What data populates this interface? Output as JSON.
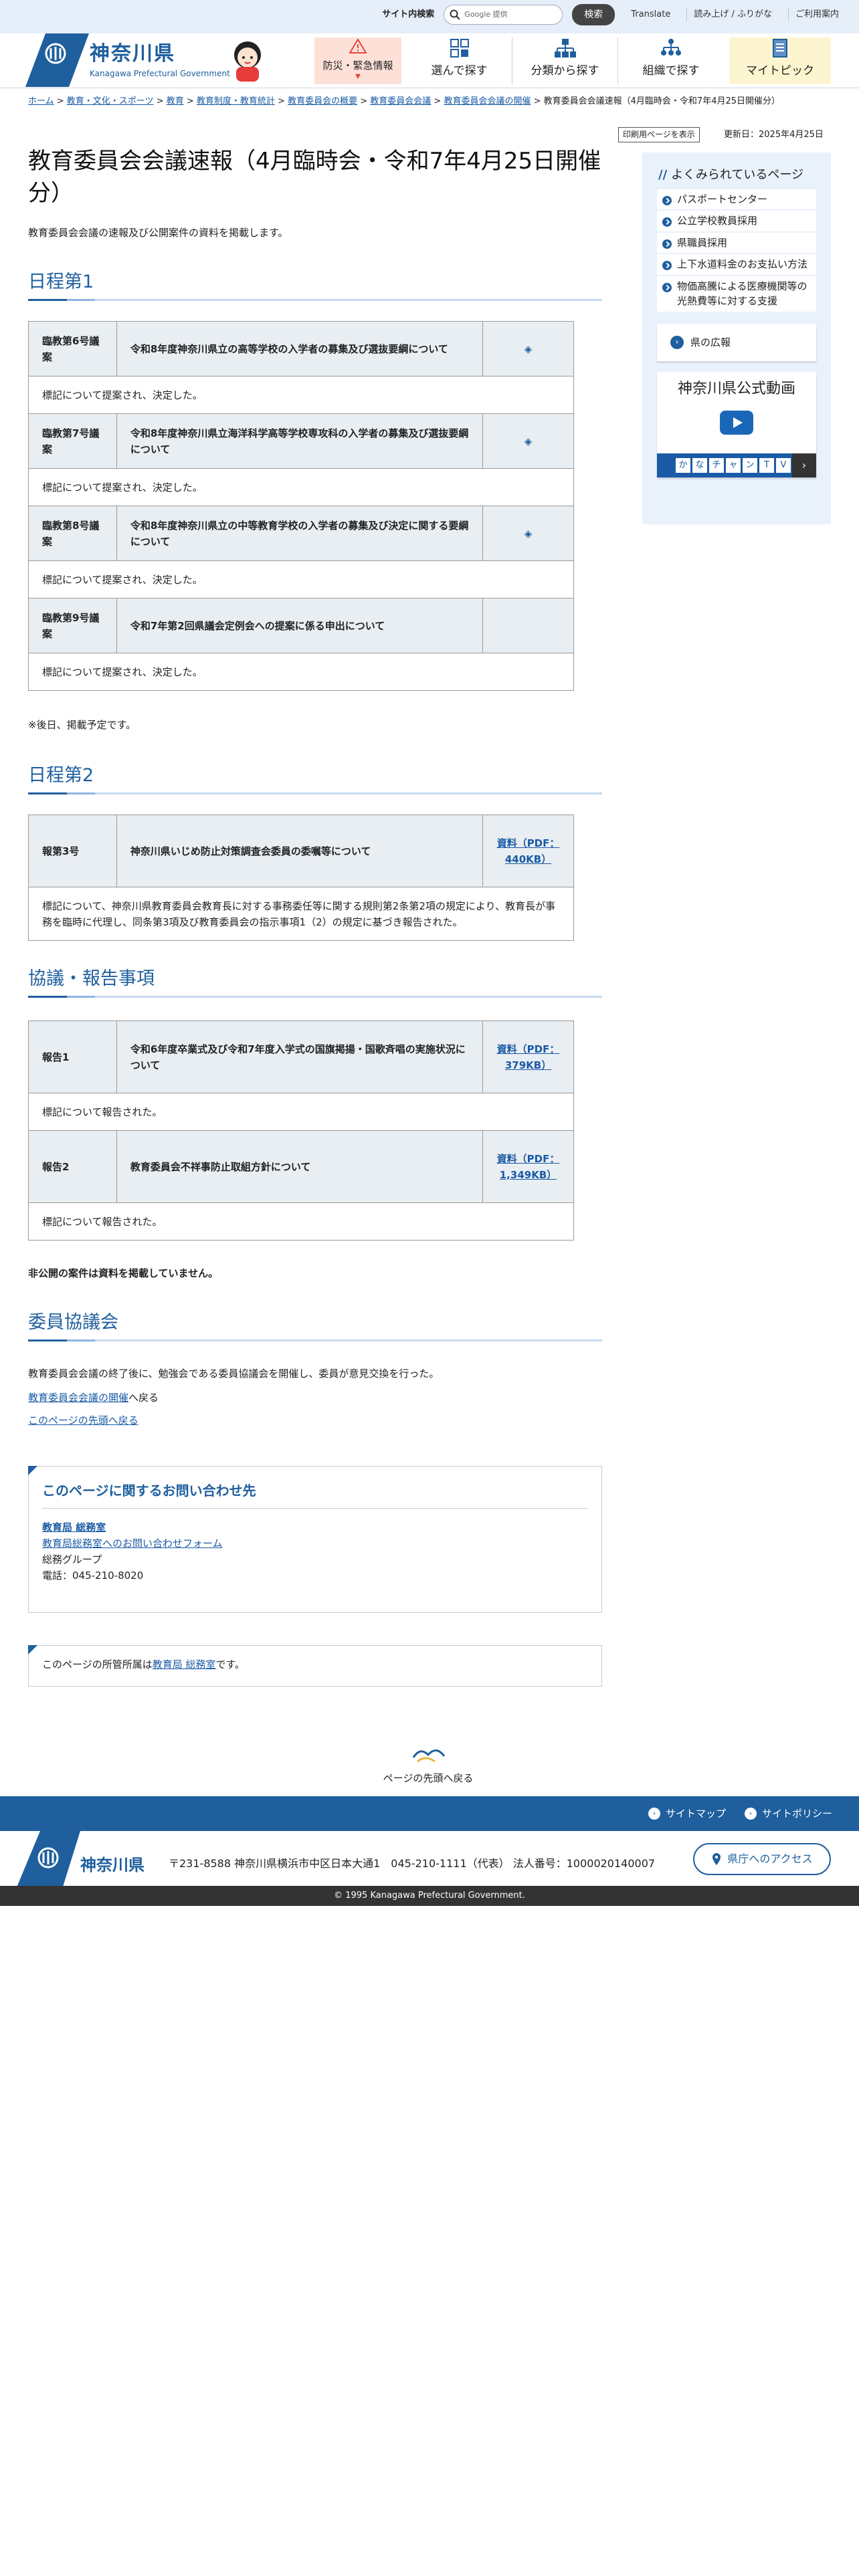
{
  "topbar": {
    "search_label": "サイト内検索",
    "search_placeholder": "Google 提供",
    "search_button": "検索",
    "links": [
      "Translate",
      "読み上げ / ふりがな",
      "ご利用案内"
    ]
  },
  "header": {
    "pref_name": "神奈川県",
    "pref_name_en": "Kanagawa Prefectural Government",
    "nav": [
      "防災・緊急情報",
      "選んで探す",
      "分類から探す",
      "組織で探す",
      "マイトピック"
    ]
  },
  "breadcrumb": {
    "items": [
      "ホーム",
      "教育・文化・スポーツ",
      "教育",
      "教育制度・教育統計",
      "教育委員会の概要",
      "教育委員会会議",
      "教育委員会会議の開催"
    ],
    "current": "教育委員会会議速報（4月臨時会・令和7年4月25日開催分）",
    "separator": " > "
  },
  "page": {
    "print_button": "印刷用ページを表示",
    "updated": "更新日：2025年4月25日",
    "title": "教育委員会会議速報（4月臨時会・令和7年4月25日開催分）",
    "lead": "教育委員会会議の速報及び公開案件の資料を掲載します。"
  },
  "section1": {
    "heading": "日程第1",
    "rows": [
      {
        "num": "臨教第6号議案",
        "title": "令和8年度神奈川県立の高等学校の入学者の募集及び選抜要綱について",
        "doc": "◈",
        "note": "標記について提案され、決定した。"
      },
      {
        "num": "臨教第7号議案",
        "title": "令和8年度神奈川県立海洋科学高等学校専攻科の入学者の募集及び選抜要綱について",
        "doc": "◈",
        "note": "標記について提案され、決定した。"
      },
      {
        "num": "臨教第8号議案",
        "title": "令和8年度神奈川県立の中等教育学校の入学者の募集及び決定に関する要綱について",
        "doc": "◈",
        "note": "標記について提案され、決定した。"
      },
      {
        "num": "臨教第9号議案",
        "title": "令和7年第2回県議会定例会への提案に係る申出について",
        "doc": "",
        "note": "標記について提案され、決定した。"
      }
    ],
    "footnote": "※後日、掲載予定です。"
  },
  "section2": {
    "heading": "日程第2",
    "rows": [
      {
        "num": "報第3号",
        "title": "神奈川県いじめ防止対策調査会委員の委嘱等について",
        "doc": "資料（PDF：440KB）",
        "note": "標記について、神奈川県教育委員会教育長に対する事務委任等に関する規則第2条第2項の規定により、教育長が事務を臨時に代理し、同条第3項及び教育委員会の指示事項1（2）の規定に基づき報告された。"
      }
    ]
  },
  "section3": {
    "heading": "協議・報告事項",
    "rows": [
      {
        "num": "報告1",
        "title": "令和6年度卒業式及び令和7年度入学式の国旗掲揚・国歌斉唱の実施状況について",
        "doc": "資料（PDF：379KB）",
        "note": "標記について報告された。"
      },
      {
        "num": "報告2",
        "title": "教育委員会不祥事防止取組方針について",
        "doc": "資料（PDF：1,349KB）",
        "note": "標記について報告された。"
      }
    ],
    "footnote": "非公開の案件は資料を掲載していません。"
  },
  "section4": {
    "heading": "委員協議会",
    "text": "教育委員会会議の終了後に、勉強会である委員協議会を開催し、委員が意見交換を行った。",
    "back_link": "教育委員会会議の開催",
    "back_suffix": "へ戻る",
    "top_link": "このページの先頭へ戻る"
  },
  "contact": {
    "heading": "このページに関するお問い合わせ先",
    "dept": "教育局 総務室",
    "form_link": "教育局総務室へのお問い合わせフォーム",
    "group": "総務グループ",
    "tel": "電話：045-210-8020"
  },
  "owner": {
    "prefix": "このページの所管所属は",
    "dept": "教育局 総務室",
    "suffix": "です。"
  },
  "sidebar": {
    "heading": "よくみられているページ",
    "items": [
      "パスポートセンター",
      "公立学校教員採用",
      "県職員採用",
      "上下水道料金のお支払い方法",
      "物価高騰による医療機関等の光熱費等に対する支援"
    ],
    "koho": "県の広報",
    "video_title": "神奈川県公式動画",
    "video_chars": [
      "か",
      "な",
      "チ",
      "ャ",
      "ン",
      "T",
      "V"
    ]
  },
  "pagetop": "ページの先頭へ戻る",
  "footer": {
    "links": [
      "サイトマップ",
      "サイトポリシー"
    ],
    "name": "神奈川県",
    "address": "〒231-8588 神奈川県横浜市中区日本大通1　045-210-1111（代表）  法人番号：1000020140007",
    "access": "県庁へのアクセス",
    "copyright": "© 1995 Kanagawa Prefectural Government."
  },
  "colors": {
    "brand": "#1f5f9e",
    "link": "#1a5aa6",
    "emergency_bg": "#fde1d8",
    "mytopic_bg": "#fdf5cf"
  }
}
